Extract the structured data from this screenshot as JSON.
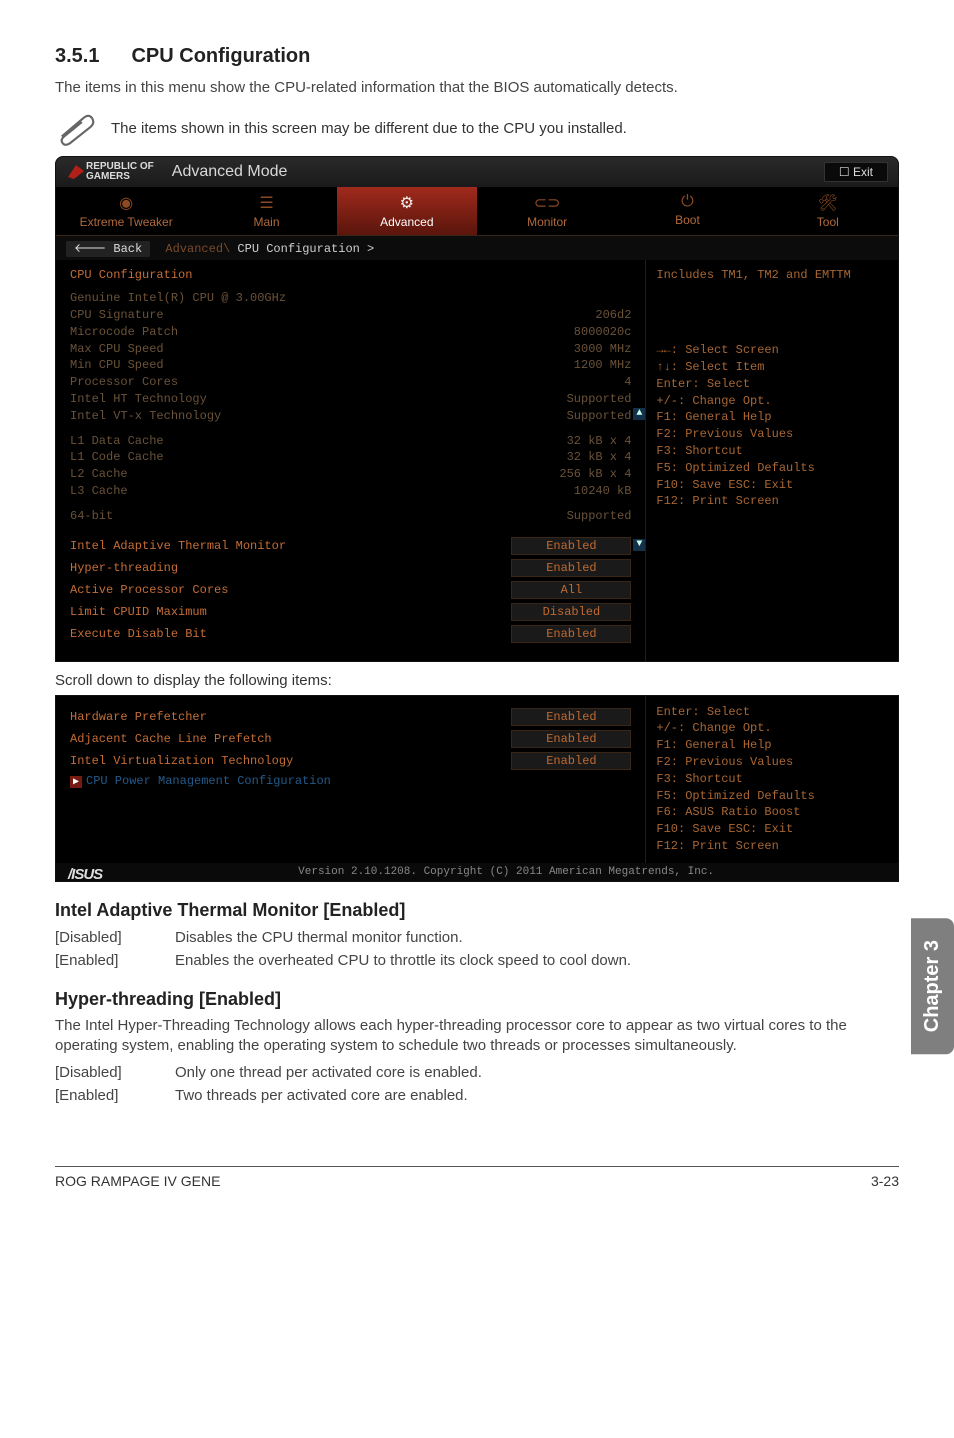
{
  "section": {
    "number": "3.5.1",
    "title": "CPU Configuration"
  },
  "intro": "The items in this menu show the CPU-related information that the BIOS automatically detects.",
  "note": "The items shown in this screen may be different due to the CPU you installed.",
  "bios": {
    "brand_top": "REPUBLIC OF",
    "brand_bottom": "GAMERS",
    "mode": "Advanced Mode",
    "exit": "Exit",
    "tabs": {
      "extreme": "Extreme Tweaker",
      "main": "Main",
      "advanced": "Advanced",
      "monitor": "Monitor",
      "boot": "Boot",
      "tool": "Tool"
    },
    "crumb_back": "Back",
    "crumb_path_a": "Advanced\\",
    "crumb_path_b": "CPU Configuration >",
    "body_title": "CPU Configuration",
    "info_rows": [
      {
        "k": "Genuine Intel(R) CPU @ 3.00GHz",
        "v": ""
      },
      {
        "k": "CPU Signature",
        "v": "206d2"
      },
      {
        "k": "Microcode Patch",
        "v": "8000020c"
      },
      {
        "k": "Max CPU Speed",
        "v": "3000 MHz"
      },
      {
        "k": "Min CPU Speed",
        "v": "1200 MHz"
      },
      {
        "k": "Processor Cores",
        "v": "4"
      },
      {
        "k": "Intel HT Technology",
        "v": "Supported"
      },
      {
        "k": "Intel VT-x Technology",
        "v": "Supported"
      }
    ],
    "cache_rows": [
      {
        "k": "L1 Data Cache",
        "v": "32 kB x 4"
      },
      {
        "k": "L1 Code Cache",
        "v": "32 kB x 4"
      },
      {
        "k": "L2 Cache",
        "v": "256 kB x 4"
      },
      {
        "k": "L3 Cache",
        "v": "10240 kB"
      }
    ],
    "row64k": "64-bit",
    "row64v": "Supported",
    "options": [
      {
        "label": "Intel Adaptive Thermal Monitor",
        "val": "Enabled"
      },
      {
        "label": "Hyper-threading",
        "val": "Enabled"
      },
      {
        "label": "Active Processor Cores",
        "val": "All"
      },
      {
        "label": "Limit CPUID Maximum",
        "val": "Disabled"
      },
      {
        "label": "Execute Disable Bit",
        "val": "Enabled"
      }
    ],
    "help_header": "Includes TM1, TM2 and EMTTM",
    "help_lines": [
      "→←: Select Screen",
      "↑↓: Select Item",
      "Enter: Select",
      "+/-: Change Opt.",
      "F1: General Help",
      "F2: Previous Values",
      "F3: Shortcut",
      "F5: Optimized Defaults",
      "F10: Save  ESC: Exit",
      "F12: Print Screen"
    ]
  },
  "scrolltxt": "Scroll down to display the following items:",
  "bios2": {
    "rows": [
      {
        "label": "Hardware Prefetcher",
        "val": "Enabled"
      },
      {
        "label": "Adjacent Cache Line Prefetch",
        "val": "Enabled"
      },
      {
        "label": "Intel Virtualization Technology",
        "val": "Enabled"
      }
    ],
    "nav": "CPU Power Management Configuration",
    "help2": [
      "Enter: Select",
      "+/-: Change Opt.",
      "F1: General Help",
      "F2: Previous Values",
      "F3: Shortcut",
      "F5: Optimized Defaults",
      "F6: ASUS Ratio Boost",
      "F10: Save  ESC: Exit",
      "F12: Print Screen"
    ],
    "asus": "/ISUS",
    "version": "Version 2.10.1208. Copyright (C) 2011 American Megatrends, Inc."
  },
  "h_iatm": "Intel Adaptive Thermal Monitor [Enabled]",
  "iatm_dis_k": "[Disabled]",
  "iatm_dis_v": "Disables the CPU thermal monitor function.",
  "iatm_en_k": "[Enabled]",
  "iatm_en_v": "Enables the overheated CPU to throttle its clock speed to cool down.",
  "h_ht": "Hyper-threading [Enabled]",
  "ht_para": "The Intel Hyper-Threading Technology allows each hyper-threading processor core to appear as two virtual cores to the operating system, enabling the operating system to schedule two threads or processes simultaneously.",
  "ht_dis_k": "[Disabled]",
  "ht_dis_v": "Only one thread per activated core is enabled.",
  "ht_en_k": "[Enabled]",
  "ht_en_v": "Two threads per activated core are enabled.",
  "sidetab": "Chapter 3",
  "footer_left": "ROG RAMPAGE IV GENE",
  "footer_right": "3-23"
}
